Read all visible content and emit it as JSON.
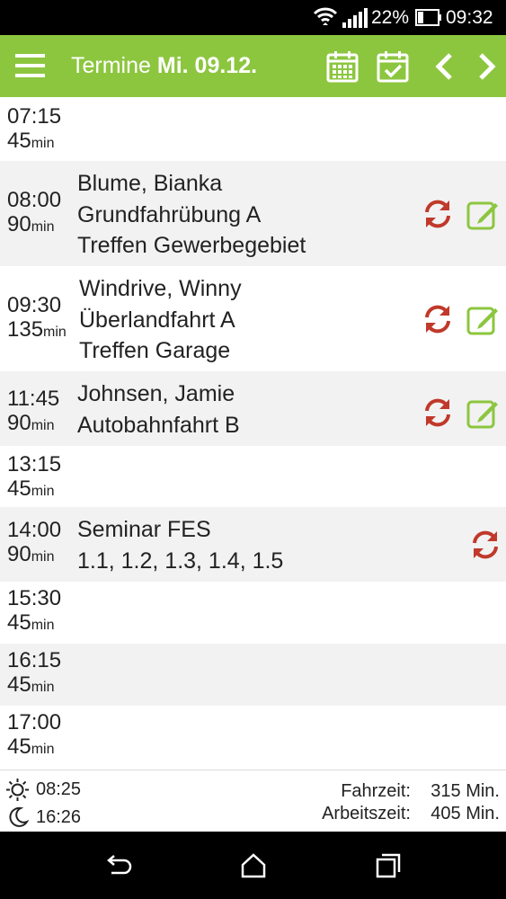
{
  "status": {
    "battery_pct": "22%",
    "time": "09:32"
  },
  "toolbar": {
    "title_prefix": "Termine",
    "title_date": "Mi. 09.12."
  },
  "appointments": [
    {
      "time": "07:15",
      "duration": "45",
      "unit": "min",
      "lines": []
    },
    {
      "time": "08:00",
      "duration": "90",
      "unit": "min",
      "lines": [
        "Blume, Bianka",
        "Grundfahrübung A",
        "Treffen Gewerbegebiet"
      ]
    },
    {
      "time": "09:30",
      "duration": "135",
      "unit": "min",
      "lines": [
        "Windrive, Winny",
        "Überlandfahrt A",
        "Treffen Garage"
      ]
    },
    {
      "time": "11:45",
      "duration": "90",
      "unit": "min",
      "lines": [
        "Johnsen, Jamie",
        "Autobahnfahrt B"
      ]
    },
    {
      "time": "13:15",
      "duration": "45",
      "unit": "min",
      "lines": []
    },
    {
      "time": "14:00",
      "duration": "90",
      "unit": "min",
      "lines": [
        "Seminar FES",
        "1.1, 1.2, 1.3, 1.4, 1.5"
      ]
    },
    {
      "time": "15:30",
      "duration": "45",
      "unit": "min",
      "lines": []
    },
    {
      "time": "16:15",
      "duration": "45",
      "unit": "min",
      "lines": []
    },
    {
      "time": "17:00",
      "duration": "45",
      "unit": "min",
      "lines": []
    }
  ],
  "footer": {
    "sunrise": "08:25",
    "sunset": "16:26",
    "fahrzeit_label": "Fahrzeit:",
    "fahrzeit_value": "315 Min.",
    "arbeitszeit_label": "Arbeitszeit:",
    "arbeitszeit_value": "405 Min."
  },
  "colors": {
    "accent": "#8cc63f",
    "refresh": "#c0392b",
    "edit": "#8cc63f"
  }
}
